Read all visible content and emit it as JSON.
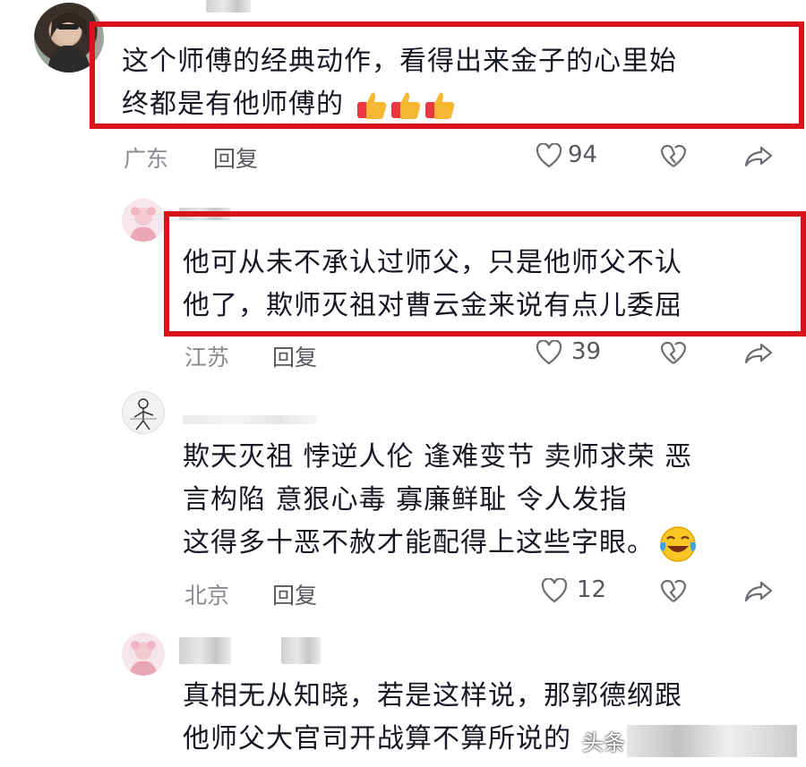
{
  "comments": [
    {
      "text_lines": [
        "这个师傅的经典动作，看得出来金子的心里始",
        "终都是有他师傅的"
      ],
      "location": "广东",
      "reply_label": "回复",
      "like_count": "94",
      "emoji": "thumbs-up x3"
    },
    {
      "text_lines": [
        "他可从未不承认过师父，只是他师父不认",
        "他了，欺师灭祖对曹云金来说有点儿委屈"
      ],
      "location": "江苏",
      "reply_label": "回复",
      "like_count": "39"
    },
    {
      "text_lines": [
        "欺天灭祖 悖逆人伦 逢难变节 卖师求荣 恶",
        "言构陷 意狠心毒 寡廉鲜耻 令人发指",
        "这得多十恶不赦才能配得上这些字眼。"
      ],
      "location": "北京",
      "reply_label": "回复",
      "like_count": "12",
      "emoji": "laughing-crying"
    },
    {
      "text_lines": [
        "真相无从知晓，若是这样说，那郭德纲跟",
        "他师父大官司开战算不算所说的"
      ]
    }
  ],
  "watermark": "头条",
  "colors": {
    "highlight_border": "#d8131c",
    "meta_text": "#8a8b91"
  }
}
